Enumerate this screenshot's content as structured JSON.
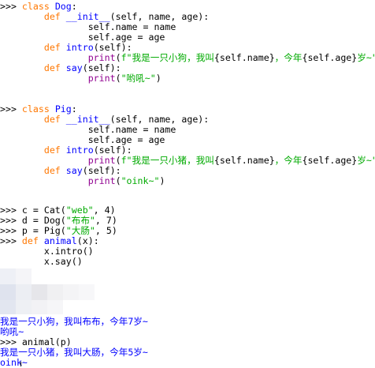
{
  "shell": {
    "prompt": ">>> ",
    "dog_class": {
      "class_kw": "class",
      "name": "Dog",
      "colon": ":",
      "init_def": "def",
      "init_name": "__init__",
      "init_args": "(self, name, age):",
      "assign_name": "self.name = name",
      "assign_age": "self.age = age",
      "intro_def": "def",
      "intro_name": "intro",
      "intro_args": "(self):",
      "print_kw": "print",
      "intro_str_a": "f\"我是一只小狗，我叫",
      "intro_str_b": "{self.name}",
      "intro_str_c": "，今年",
      "intro_str_d": "{self.age}",
      "intro_str_e": "岁~\"",
      "close_paren": ")",
      "say_def": "def",
      "say_name": "say",
      "say_args": "(self):",
      "say_str": "\"哟吼~\""
    },
    "pig_class": {
      "class_kw": "class",
      "name": "Pig",
      "colon": ":",
      "init_def": "def",
      "init_name": "__init__",
      "init_args": "(self, name, age):",
      "assign_name": "self.name = name",
      "assign_age": "self.age = age",
      "intro_def": "def",
      "intro_name": "intro",
      "intro_args": "(self):",
      "print_kw": "print",
      "intro_str_a": "f\"我是一只小猪，我叫",
      "intro_str_b": "{self.name}",
      "intro_str_c": "，今年",
      "intro_str_d": "{self.age}",
      "intro_str_e": "岁~\"",
      "close_paren": ")",
      "say_def": "def",
      "say_name": "say",
      "say_args": "(self):",
      "say_str": "\"oink~\""
    },
    "assignments": [
      {
        "lhs": "c = Cat(",
        "str": "\"web\"",
        "rest": ", 4)"
      },
      {
        "lhs": "d = Dog(",
        "str": "\"布布\"",
        "rest": ", 7)"
      },
      {
        "lhs": "p = Pig(",
        "str": "\"大肠\"",
        "rest": ", 5)"
      }
    ],
    "animal_func": {
      "def_kw": "def",
      "name": "animal",
      "args": "(x):",
      "body1": "x.intro()",
      "body2": "x.say()"
    },
    "outputs": {
      "dog_intro": "我是一只小狗，我叫布布，今年7岁~",
      "dog_say": "哟吼~",
      "call_animal_p": "animal(p)",
      "pig_intro": "我是一只小猪，我叫大肠，今年5岁~",
      "pig_say": "oink~"
    }
  },
  "colors": {
    "keyword": "#ff7700",
    "definition": "#0000ff",
    "builtin": "#900090",
    "string": "#00aa00",
    "output": "#0000ff"
  }
}
